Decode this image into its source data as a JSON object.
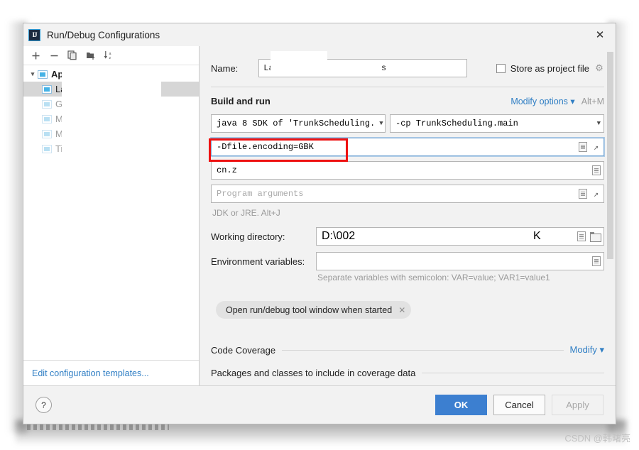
{
  "window": {
    "title": "Run/Debug Configurations",
    "logo_text": "IJ",
    "close_label": "✕"
  },
  "sidebar": {
    "toolbar": [
      {
        "name": "add-configuration-button",
        "glyph": "＋"
      },
      {
        "name": "remove-configuration-button",
        "glyph": "−"
      },
      {
        "name": "copy-configuration-button",
        "glyph": "⧉"
      },
      {
        "name": "new-folder-button",
        "glyph": "⬚"
      },
      {
        "name": "sort-configurations-button",
        "glyph": "↓"
      }
    ],
    "sort_label": "az",
    "tree": [
      {
        "label": "Application",
        "level": 0,
        "expanded": true,
        "selected": false,
        "dim": false
      },
      {
        "label": "La",
        "level": 1,
        "expanded": false,
        "selected": true,
        "dim": false
      },
      {
        "label": "G",
        "level": 1,
        "expanded": false,
        "selected": false,
        "dim": true
      },
      {
        "label": "M",
        "level": 1,
        "expanded": false,
        "selected": false,
        "dim": true
      },
      {
        "label": "M",
        "level": 1,
        "expanded": false,
        "selected": false,
        "dim": true
      },
      {
        "label": "Ti",
        "level": 1,
        "expanded": false,
        "selected": false,
        "dim": true
      }
    ],
    "edit_templates_link": "Edit configuration templates..."
  },
  "main": {
    "name_label": "Name:",
    "name_value": "Lar                    s",
    "store_as_project_file": "Store as project file",
    "store_checked": false,
    "build_and_run": {
      "title": "Build and run",
      "modify_options": "Modify options",
      "modify_shortcut": "Alt+M",
      "jre_combo": "java 8 SDK of 'TrunkScheduling.",
      "module_combo": "-cp TrunkScheduling.main",
      "vm_options_value": "-Dfile.encoding=GBK",
      "main_class_value": "cn.z",
      "program_arguments_placeholder": "Program arguments",
      "jdk_hint": "JDK or JRE. Alt+J"
    },
    "working_directory_label": "Working directory:",
    "working_directory_value": "D:\\002",
    "working_directory_tail": "K",
    "environment_variables_label": "Environment variables:",
    "environment_variables_value": "",
    "environment_hint": "Separate variables with semicolon: VAR=value; VAR1=value1",
    "open_tool_window_chip": "Open run/debug tool window when started",
    "chip_close": "✕",
    "code_coverage_title": "Code Coverage",
    "code_coverage_modify": "Modify",
    "coverage_packages_title": "Packages and classes to include in coverage data"
  },
  "footer": {
    "help": "?",
    "ok": "OK",
    "cancel": "Cancel",
    "apply": "Apply"
  },
  "watermark": "CSDN @韩曙亮",
  "colors": {
    "accent": "#3c7fd0",
    "link": "#2f7ec4",
    "annotation": "#ee1111"
  }
}
